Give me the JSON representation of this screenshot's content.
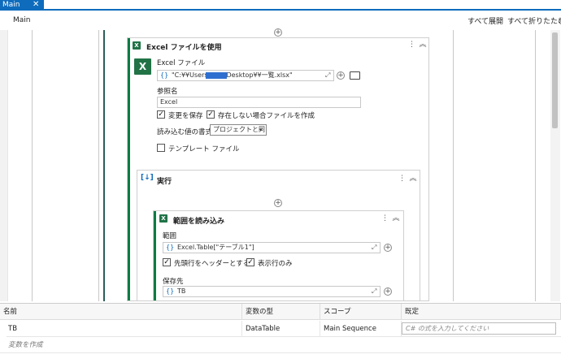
{
  "tab": {
    "label": "Main",
    "close": "✕"
  },
  "header": {
    "breadcrumb": "Main",
    "expand_all": "すべて展開",
    "collapse_all": "すべて折りたたむ"
  },
  "excel_scope": {
    "title": "Excel ファイルを使用",
    "excel_file_label": "Excel ファイル",
    "file_path": "\"C:¥¥Users¥¥          ¥¥Desktop¥¥一覧.xlsx\"",
    "ref_name_label": "参照名",
    "ref_name_value": "Excel",
    "save_changes_label": "変更を保存",
    "save_changes_checked": true,
    "create_if_missing_label": "存在しない場合ファイルを作成",
    "create_if_missing_checked": true,
    "read_format_label": "読み込む値の書式",
    "read_format_value": "プロジェクトと同じ",
    "template_file_label": "テンプレート ファイル",
    "template_file_checked": false
  },
  "do_block": {
    "title": "実行"
  },
  "read_range": {
    "title": "範囲を読み込み",
    "range_label": "範囲",
    "range_value": "Excel.Table[\"テーブル1\"]",
    "has_headers_label": "先頭行をヘッダーとする",
    "has_headers_checked": true,
    "visible_rows_label": "表示行のみ",
    "visible_rows_checked": true,
    "save_to_label": "保存先",
    "save_to_value": "TB"
  },
  "variables": {
    "columns": [
      "名前",
      "変数の型",
      "スコープ",
      "既定"
    ],
    "rows": [
      {
        "name": "TB",
        "type": "DataTable",
        "scope": "Main Sequence",
        "default_placeholder": "C# の式を入力してください"
      }
    ],
    "create_label": "変数を作成"
  },
  "icons": [
    "close-icon",
    "excel-icon",
    "curly-braces-icon",
    "expand-icon",
    "add-icon",
    "folder-icon",
    "more-icon",
    "collapse-icon",
    "do-icon",
    "chevron-down-icon",
    "check-icon"
  ],
  "colors": {
    "accent": "#0f6cbd",
    "excel_green": "#217346",
    "activity_bar": "#0f7b45"
  }
}
